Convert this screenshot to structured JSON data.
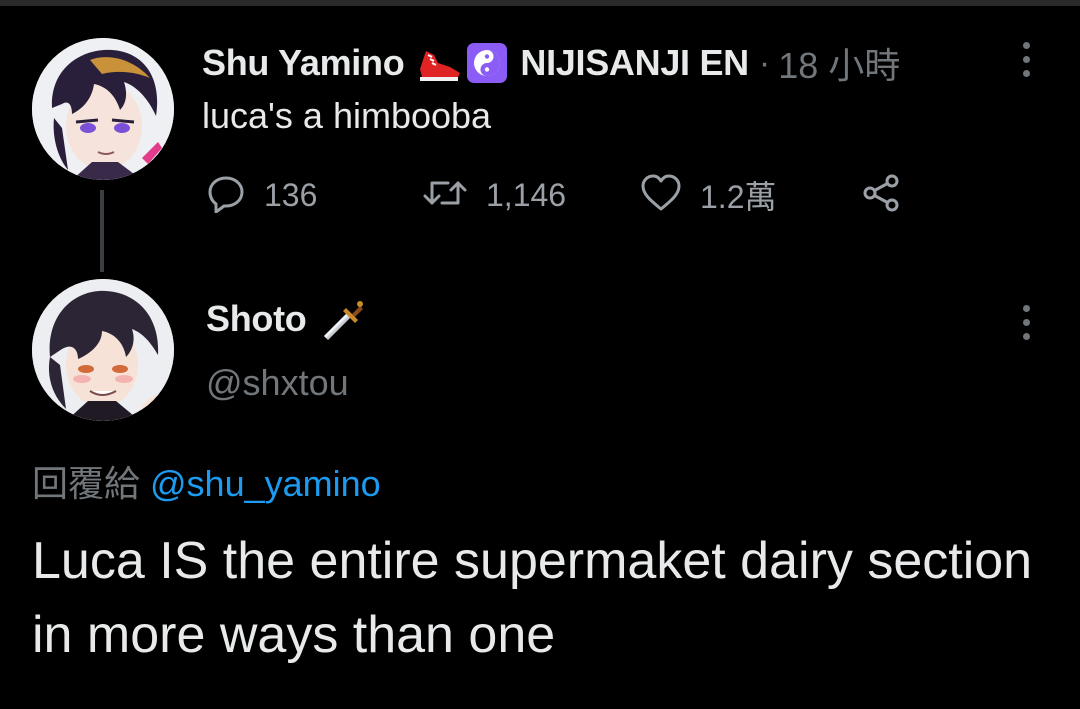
{
  "parent_tweet": {
    "author_name": "Shu Yamino",
    "author_emojis": [
      "sneaker-emoji",
      "yin-yang-emoji"
    ],
    "affiliation": "NIJISANJI EN",
    "separator": "·",
    "time": "18 小時",
    "text": "luca's a himbooba",
    "reply_count": "136",
    "retweet_count": "1,146",
    "like_count": "1.2萬"
  },
  "reply_tweet": {
    "author_name": "Shoto",
    "author_emoji": "dagger-emoji",
    "handle": "@shxtou",
    "replying_to_label": "回覆給",
    "replying_to_handle": "@shu_yamino",
    "text": "Luca IS the entire supermaket dairy section in more ways than one"
  },
  "colors": {
    "background": "#000000",
    "primary_text": "#e7e9ea",
    "secondary_text": "#71767b",
    "link": "#1d9bf0",
    "yin_yang_badge": "#8b5cf6",
    "sneaker": "#e02424"
  },
  "icons": {
    "reply": "reply-icon",
    "retweet": "retweet-icon",
    "like": "heart-icon",
    "share": "share-icon",
    "more": "more-vertical-icon"
  }
}
